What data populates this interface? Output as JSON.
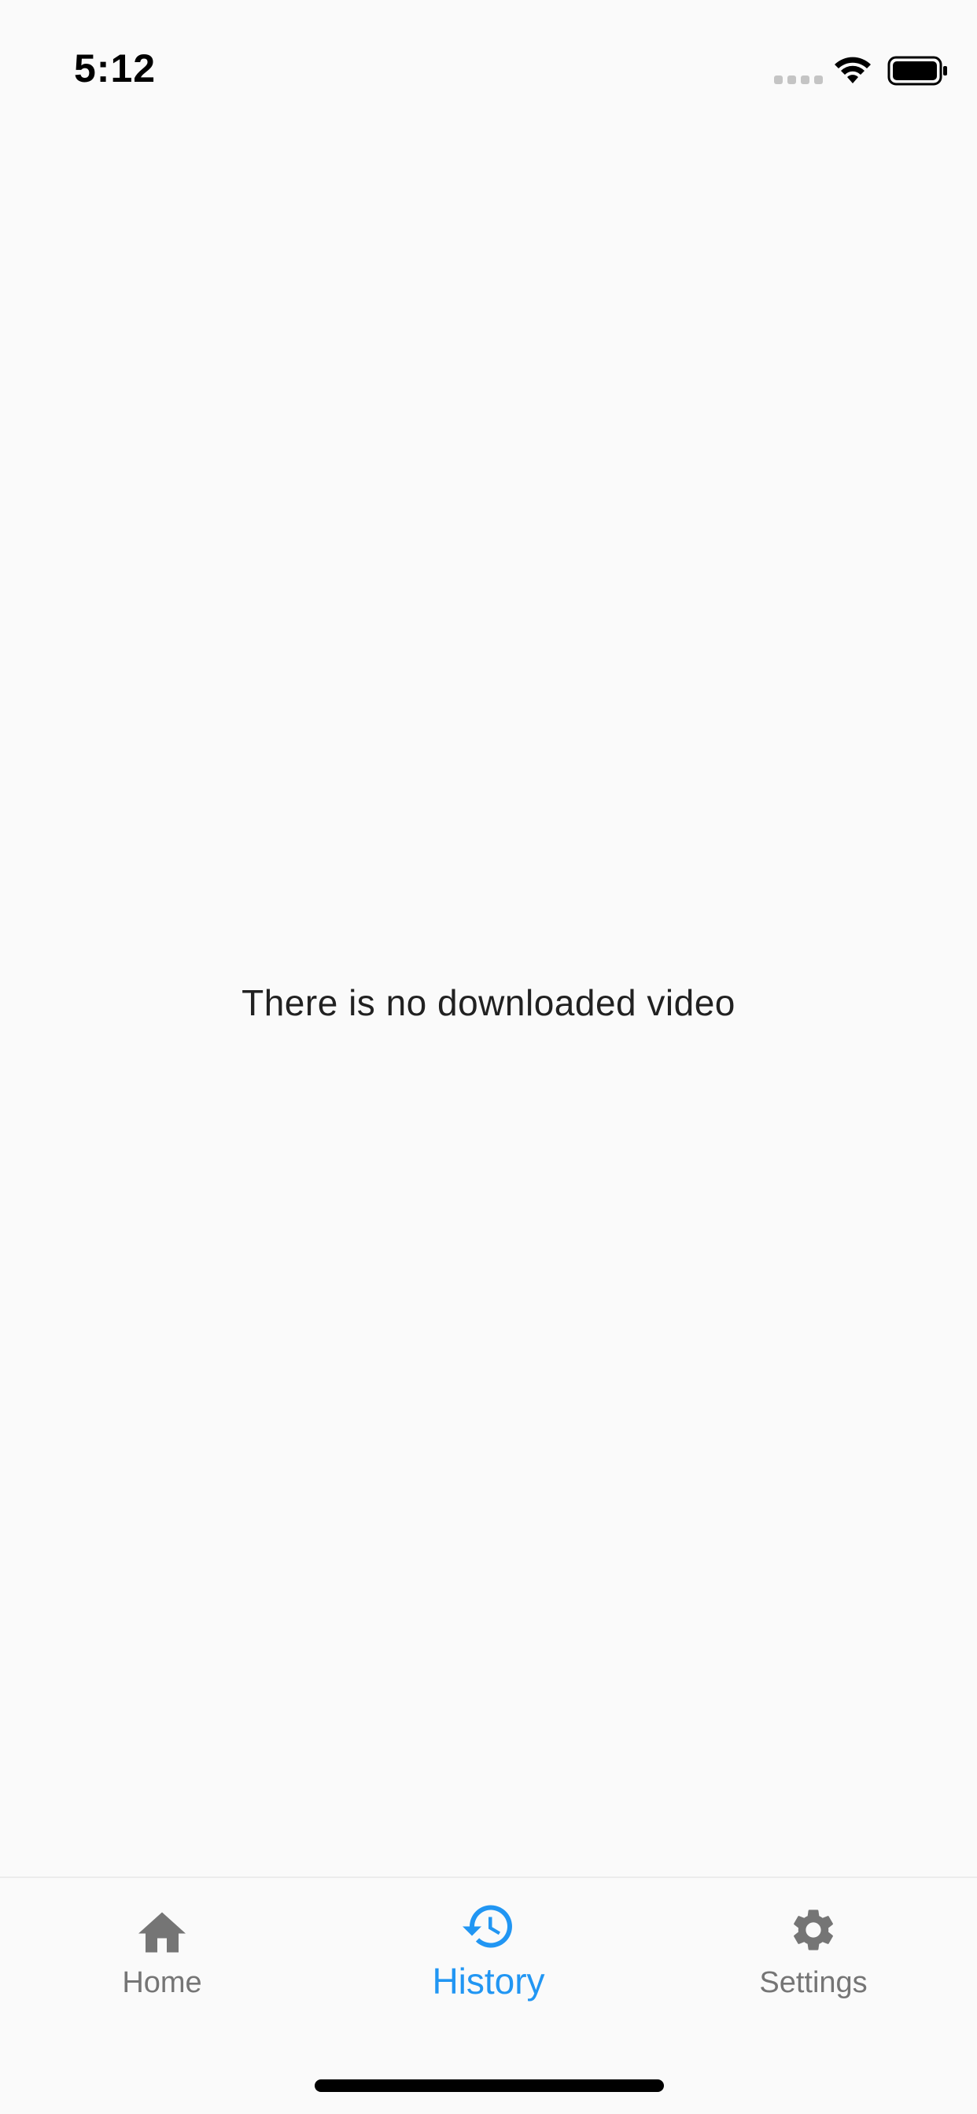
{
  "status_bar": {
    "time": "5:12"
  },
  "history": {
    "empty_message": "There is no downloaded video"
  },
  "bottom_nav": {
    "items": [
      {
        "label": "Home",
        "icon": "home-icon",
        "active": false
      },
      {
        "label": "History",
        "icon": "history-icon",
        "active": true
      },
      {
        "label": "Settings",
        "icon": "gear-icon",
        "active": false
      }
    ],
    "active_color": "#2196f3",
    "inactive_color": "#757575"
  }
}
